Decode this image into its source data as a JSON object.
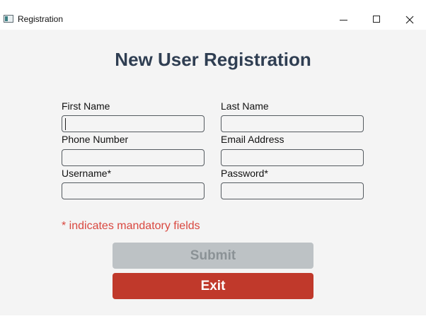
{
  "window": {
    "title": "Registration",
    "app_icon": "app-window-icon",
    "controls": {
      "minimize_icon": "minimize-icon",
      "maximize_icon": "maximize-icon",
      "close_icon": "close-icon"
    }
  },
  "form": {
    "title": "New User Registration",
    "fields": {
      "first_name": {
        "label": "First Name",
        "value": "",
        "placeholder": ""
      },
      "last_name": {
        "label": "Last Name",
        "value": "",
        "placeholder": ""
      },
      "phone_number": {
        "label": "Phone Number",
        "value": "",
        "placeholder": ""
      },
      "email_address": {
        "label": "Email Address",
        "value": "",
        "placeholder": ""
      },
      "username": {
        "label": "Username*",
        "value": "",
        "placeholder": ""
      },
      "password": {
        "label": "Password*",
        "value": "",
        "placeholder": ""
      }
    },
    "mandatory_note": "* indicates mandatory fields",
    "buttons": {
      "submit": "Submit",
      "exit": "Exit"
    }
  },
  "colors": {
    "title_text": "#2f3e52",
    "note_text": "#d9473f",
    "submit_background": "#bdc2c5",
    "submit_text": "#8b9296",
    "exit_background": "#c0392b",
    "exit_text": "#ffffff",
    "form_background": "#f4f4f4"
  }
}
